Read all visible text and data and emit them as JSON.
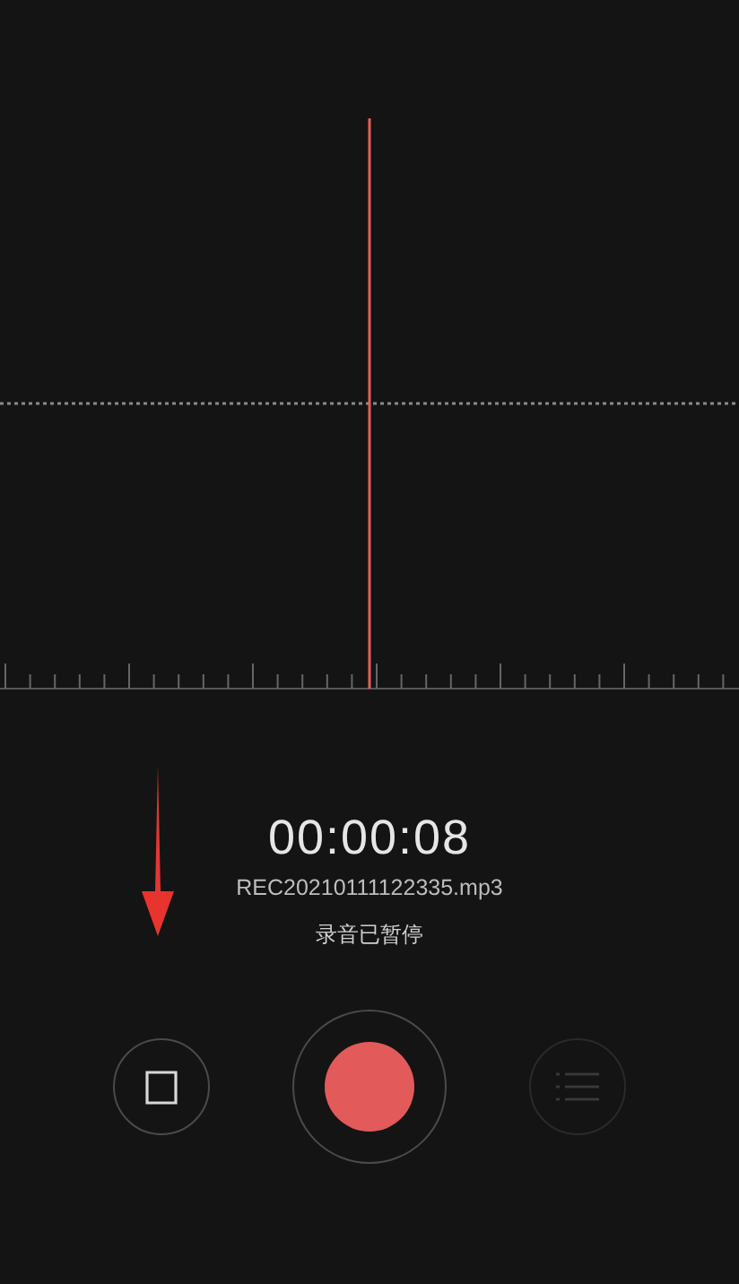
{
  "recorder": {
    "timer": "00:00:08",
    "file_name": "REC20210111122335.mp3",
    "status": "录音已暂停"
  },
  "controls": [
    {
      "kind": "stop",
      "disabled": false
    },
    {
      "kind": "record",
      "disabled": false
    },
    {
      "kind": "list",
      "disabled": true
    }
  ]
}
